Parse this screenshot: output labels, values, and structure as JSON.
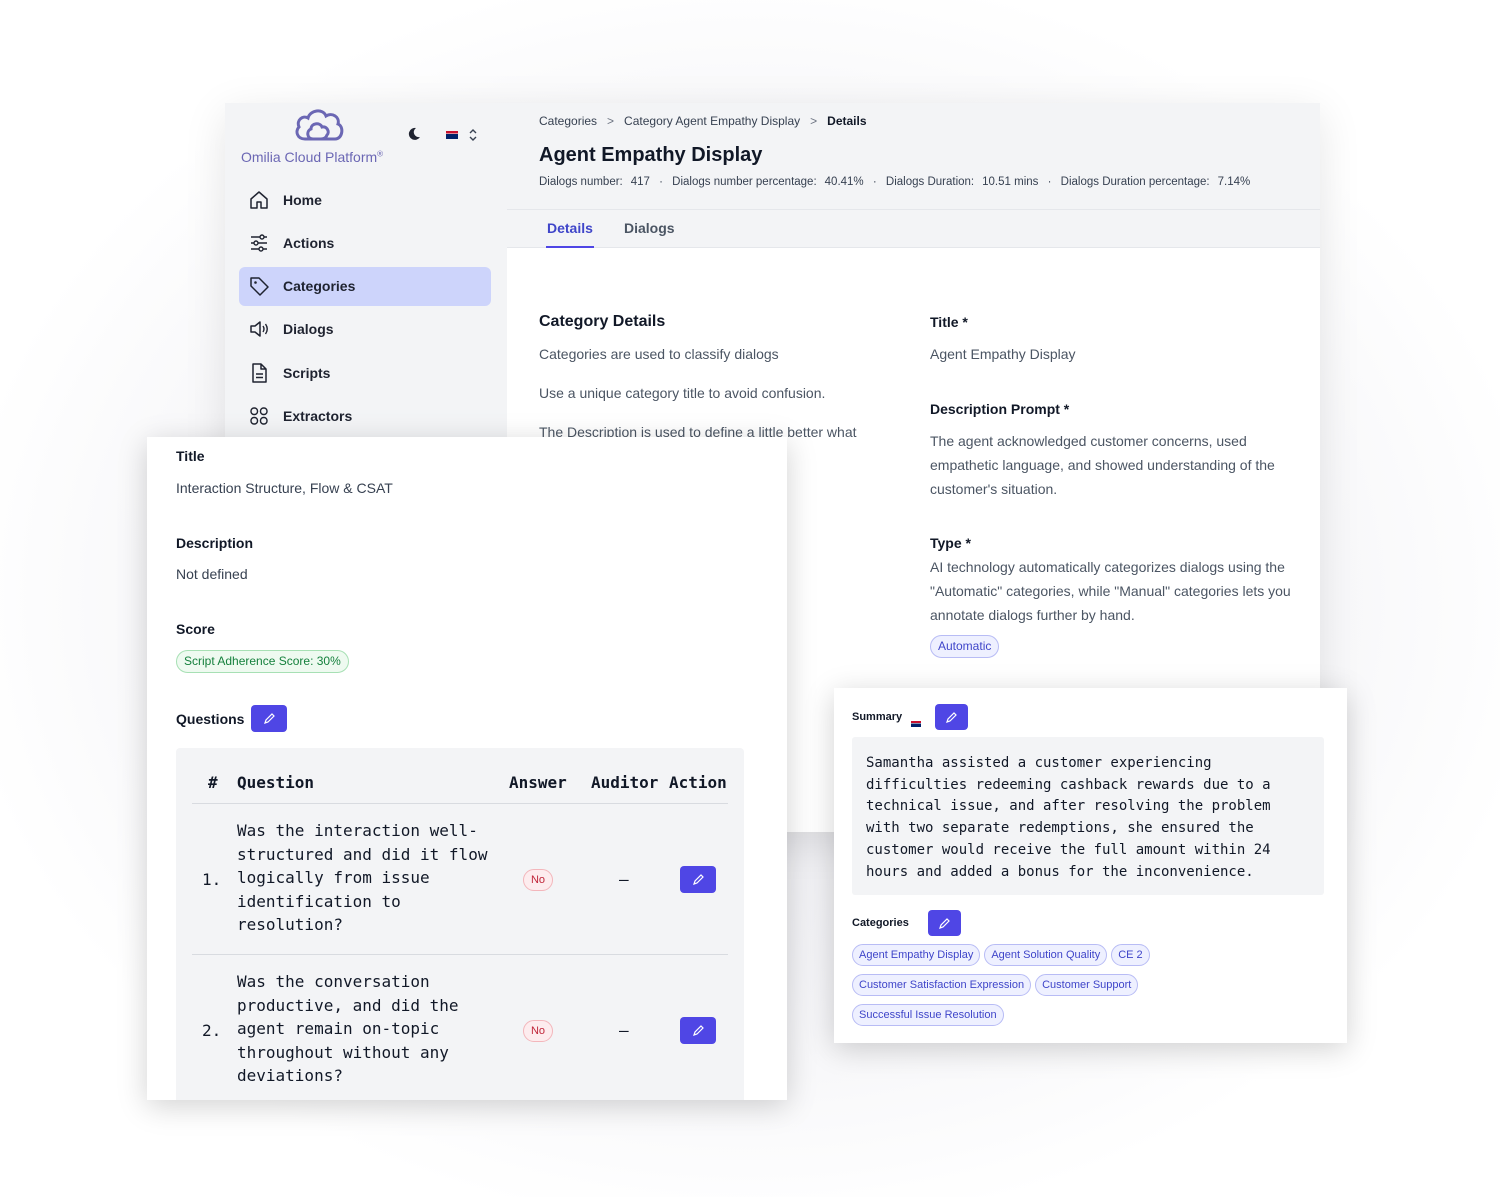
{
  "app": {
    "logo_text": "Omilia Cloud Platform",
    "logo_mark": "®"
  },
  "sidebar": {
    "items": [
      {
        "label": "Home",
        "icon": "home-icon",
        "active": false
      },
      {
        "label": "Actions",
        "icon": "sliders-icon",
        "active": false
      },
      {
        "label": "Categories",
        "icon": "tag-icon",
        "active": true
      },
      {
        "label": "Dialogs",
        "icon": "speaker-icon",
        "active": false
      },
      {
        "label": "Scripts",
        "icon": "document-icon",
        "active": false
      },
      {
        "label": "Extractors",
        "icon": "grid-icon",
        "active": false
      }
    ]
  },
  "breadcrumb": {
    "items": [
      "Categories",
      "Category Agent Empathy Display"
    ],
    "current": "Details"
  },
  "page": {
    "title": "Agent Empathy Display",
    "stats": {
      "dialogs_number_label": "Dialogs number:",
      "dialogs_number_value": "417",
      "dialogs_pct_label": "Dialogs number percentage:",
      "dialogs_pct_value": "40.41%",
      "duration_label": "Dialogs Duration:",
      "duration_value": "10.51 mins",
      "duration_pct_label": "Dialogs Duration percentage:",
      "duration_pct_value": "7.14%"
    },
    "tabs": [
      "Details",
      "Dialogs"
    ]
  },
  "category_details": {
    "title": "Category Details",
    "line1": "Categories are used to classify dialogs",
    "line2": "Use a unique category title to avoid confusion.",
    "line3": "The Description is used to define a little better what"
  },
  "form": {
    "title_label": "Title *",
    "title_value": "Agent Empathy Display",
    "desc_label": "Description Prompt *",
    "desc_value": "The agent acknowledged customer concerns, used empathetic language, and showed understanding of the customer's situation.",
    "type_label": "Type *",
    "type_desc": "AI technology automatically categorizes dialogs using the \"Automatic\" categories, while \"Manual\" categories lets you annotate dialogs further by hand.",
    "type_value": "Automatic"
  },
  "script_panel": {
    "title_label": "Title",
    "title_value": "Interaction Structure, Flow & CSAT",
    "desc_label": "Description",
    "desc_value": "Not defined",
    "score_label": "Score",
    "score_value": "Script Adherence Score: 30%",
    "questions_label": "Questions",
    "columns": [
      "#",
      "Question",
      "Answer",
      "Auditor",
      "Action"
    ],
    "questions": [
      {
        "num": "1.",
        "text": "Was the interaction well-\nstructured and did it flow\nlogically from issue\nidentification to\nresolution?",
        "answer": "No",
        "auditor": "–"
      },
      {
        "num": "2.",
        "text": "Was the conversation\nproductive, and did the\nagent remain on-topic\nthroughout without any\ndeviations?",
        "answer": "No",
        "auditor": "–"
      }
    ]
  },
  "summary_panel": {
    "summary_label": "Summary",
    "summary_text": "Samantha assisted a customer experiencing difficulties redeeming cashback rewards due to a technical issue, and after resolving the problem with two separate redemptions, she ensured the customer would receive the full amount within 24 hours and added a bonus for the inconvenience.",
    "categories_label": "Categories",
    "categories": [
      "Agent Empathy Display",
      "Agent Solution Quality",
      "CE 2",
      "Customer Satisfaction Expression",
      "Customer Support",
      "Successful Issue Resolution"
    ]
  },
  "colors": {
    "accent": "#4f46e5",
    "active_nav": "#cdd4fb",
    "logo": "#6b67b4"
  }
}
